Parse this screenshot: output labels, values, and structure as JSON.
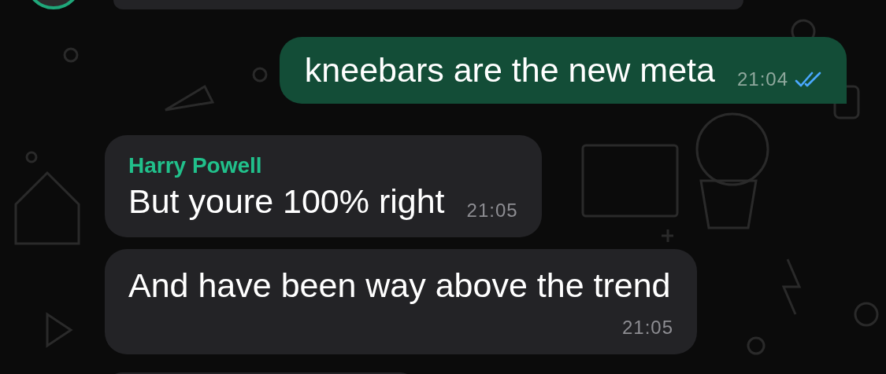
{
  "messages": [
    {
      "kind": "outgoing",
      "text": "kneebars are the new meta",
      "time": "21:04",
      "read": true
    },
    {
      "kind": "incoming",
      "sender": "Harry Powell",
      "text": "But youre 100% right",
      "time": "21:05"
    },
    {
      "kind": "incoming",
      "text": "And have been way above the trend",
      "time": "21:05"
    }
  ]
}
